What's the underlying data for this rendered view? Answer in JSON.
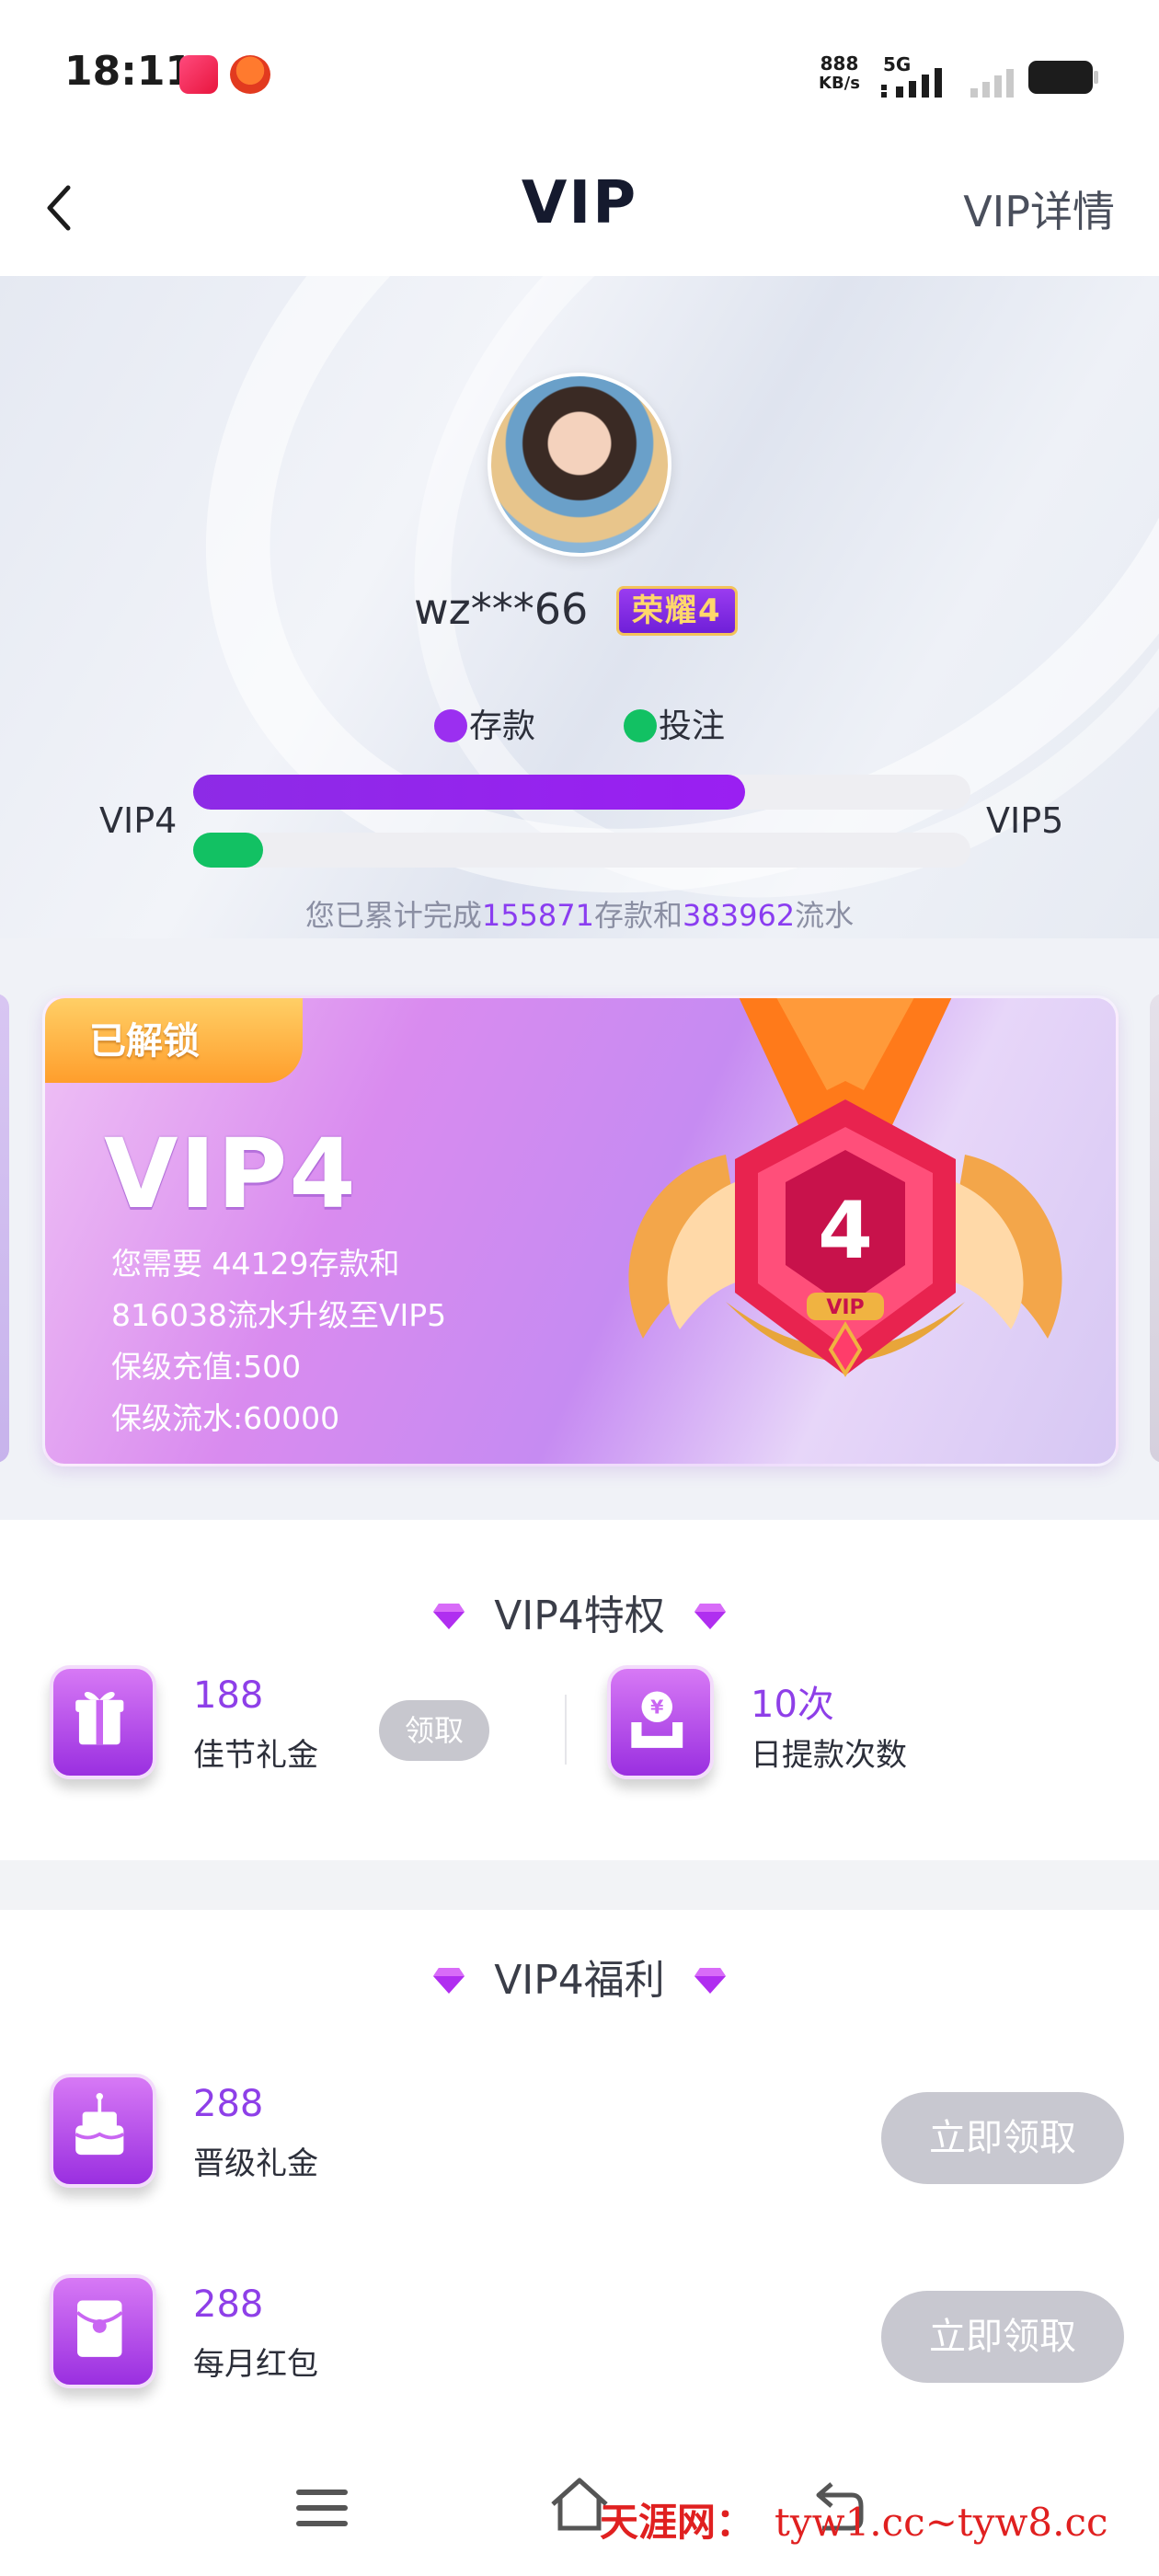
{
  "status_bar": {
    "time": "18:11",
    "net_speed": "888",
    "net_unit": "KB/s",
    "network": "5G"
  },
  "header": {
    "title": "VIP",
    "detail_link": "VIP详情",
    "back_icon": "chevron-left-icon"
  },
  "profile": {
    "username": "wz***66",
    "rank_badge": "荣耀4",
    "legend_deposit": "存款",
    "legend_bet": "投注",
    "vip_from": "VIP4",
    "vip_to": "VIP5",
    "deposit_progress": 0.71,
    "bet_progress": 0.09,
    "deposit_color": "#9b2ff0",
    "bet_color": "#12c163",
    "summary_prefix": "您已累计完成",
    "summary_deposit": "155871",
    "summary_mid": "存款和",
    "summary_turnover": "383962",
    "summary_suffix": "流水"
  },
  "vip_card": {
    "status": "已解锁",
    "level": "VIP4",
    "line1": "您需要 44129存款和",
    "line2": "816038流水升级至VIP5",
    "line3": "保级充值:500",
    "line4": "保级流水:60000",
    "medal_number": "4",
    "medal_tag": "VIP"
  },
  "privileges": {
    "title": "VIP4特权",
    "items": [
      {
        "value": "188",
        "label": "佳节礼金",
        "icon": "gift-icon",
        "action": "领取"
      },
      {
        "value": "10次",
        "label": "日提款次数",
        "icon": "withdraw-icon"
      }
    ]
  },
  "benefits": {
    "title": "VIP4福利",
    "items": [
      {
        "value": "288",
        "label": "晋级礼金",
        "icon": "cake-icon",
        "action": "立即领取"
      },
      {
        "value": "288",
        "label": "每月红包",
        "icon": "red-envelope-icon",
        "action": "立即领取"
      }
    ]
  },
  "watermark": {
    "site": "天涯网：",
    "url": "tyw1.cc~tyw8.cc"
  },
  "colors": {
    "accent_purple": "#8e3fe8",
    "claim_disabled": "#c8c8d0"
  }
}
